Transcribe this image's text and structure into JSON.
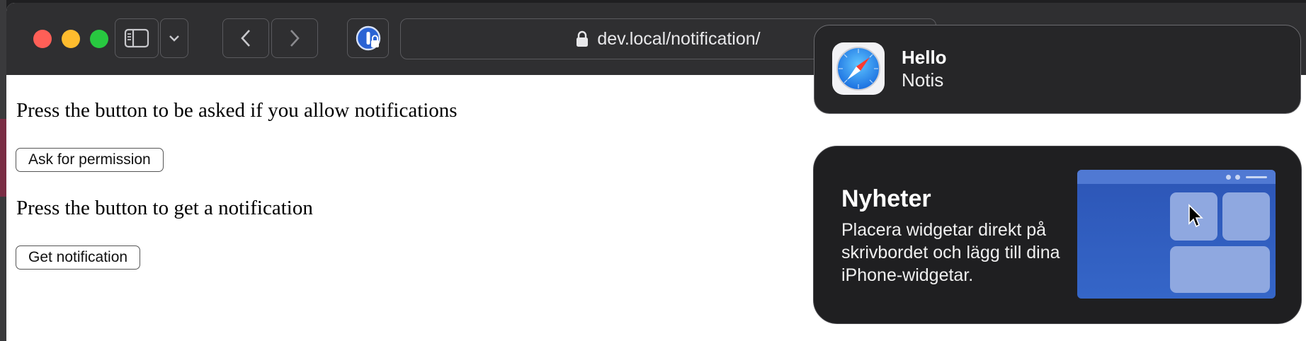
{
  "browser": {
    "url": "dev.local/notification/",
    "icons": [
      "sidebar-icon",
      "chevron-down-icon",
      "back-icon",
      "forward-icon",
      "password-extension-icon",
      "lock-icon"
    ]
  },
  "page": {
    "paragraph_1": "Press the button to be asked if you allow notifications",
    "button_permission": "Ask for permission",
    "paragraph_2": "Press the button to get a notification",
    "button_notify": "Get notification"
  },
  "notification": {
    "title": "Hello",
    "body": "Notis",
    "app_icon": "safari-compass-icon"
  },
  "widget": {
    "title": "Nyheter",
    "description": "Placera widgetar direkt på skrivbordet och lägg till dina iPhone-widgetar."
  },
  "colors": {
    "traffic_red": "#ff5f57",
    "traffic_yellow": "#febc2e",
    "traffic_green": "#28c840",
    "toolbar_bg": "#2f2f31",
    "widget_blue": "#3566c8"
  }
}
